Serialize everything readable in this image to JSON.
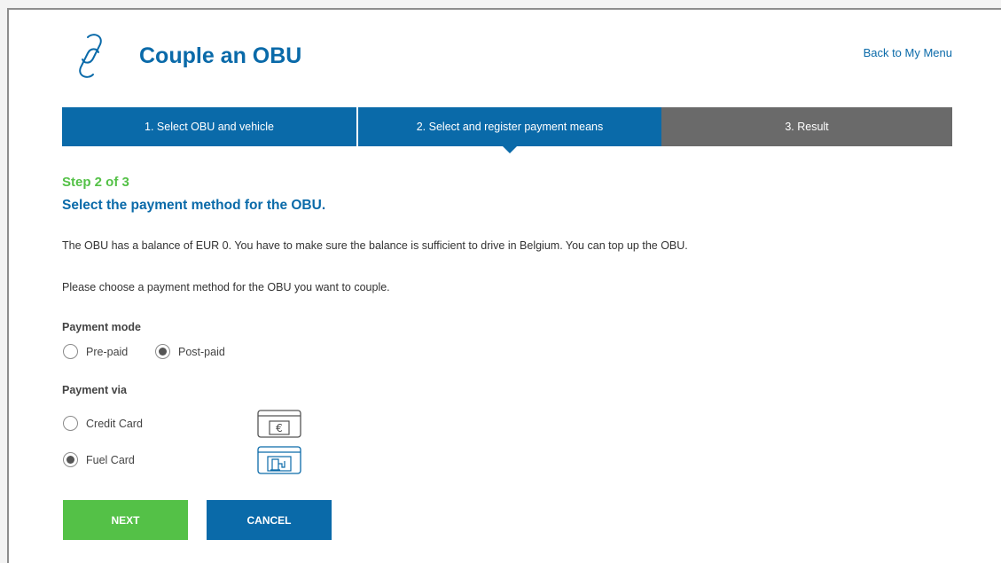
{
  "header": {
    "title": "Couple an OBU",
    "back_link": "Back to My Menu",
    "logo_icon": "chain-link-icon"
  },
  "steps": [
    {
      "label": "1. Select OBU and vehicle",
      "state": "done"
    },
    {
      "label": "2. Select and register payment means",
      "state": "active"
    },
    {
      "label": "3. Result",
      "state": "pending"
    }
  ],
  "main": {
    "step_counter": "Step 2 of 3",
    "section_title": "Select the payment method for the OBU.",
    "balance_text": "The OBU has a balance of EUR 0. You have to make sure the balance is sufficient to drive in Belgium. You can top up the OBU.",
    "instruction_text": "Please choose a payment method for the OBU you want to couple."
  },
  "payment_mode": {
    "label": "Payment mode",
    "options": [
      {
        "label": "Pre-paid",
        "checked": false
      },
      {
        "label": "Post-paid",
        "checked": true
      }
    ]
  },
  "payment_via": {
    "label": "Payment via",
    "options": [
      {
        "label": "Credit Card",
        "checked": false,
        "icon": "credit-card-euro-icon"
      },
      {
        "label": "Fuel Card",
        "checked": true,
        "icon": "fuel-card-icon"
      }
    ]
  },
  "buttons": {
    "next": "NEXT",
    "cancel": "CANCEL"
  },
  "colors": {
    "primary_blue": "#0a6aa9",
    "accent_green": "#54c147",
    "inactive_gray": "#6a6a6a"
  }
}
